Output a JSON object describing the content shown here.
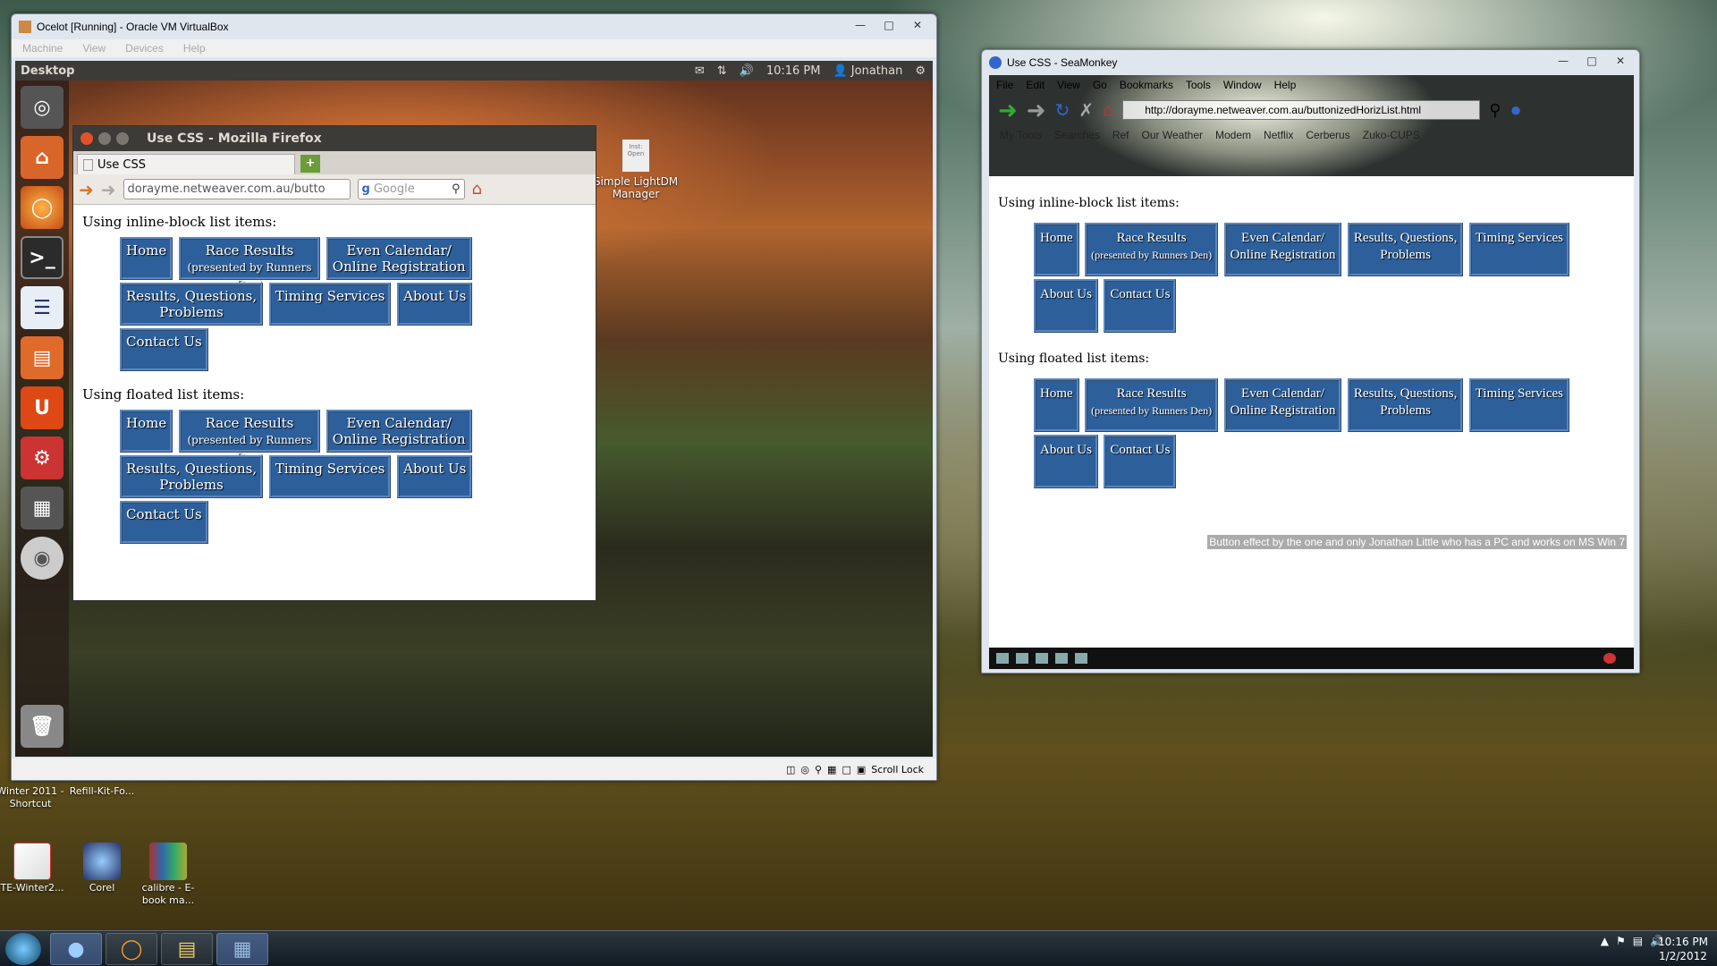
{
  "vbox": {
    "title": "Ocelot [Running] - Oracle VM VirtualBox",
    "menu": [
      "Machine",
      "View",
      "Devices",
      "Help"
    ],
    "status_right": "Scroll Lock"
  },
  "ubuntu": {
    "panel_title": "Desktop",
    "clock": "10:16 PM",
    "user": "Jonathan",
    "desktop_icon_label": "Simple LightDM Manager",
    "desktop_icon_small": "Inst: Open"
  },
  "firefox": {
    "title": "Use CSS - Mozilla Firefox",
    "tab": "Use CSS",
    "url": "dorayme.netweaver.com.au/butto",
    "search_placeholder": "Google"
  },
  "page": {
    "heading_inline": "Using inline-block list items:",
    "heading_float": "Using floated list items:",
    "buttons": {
      "home": "Home",
      "race": "Race Results",
      "race_sub": "(presented by Runners Den)",
      "even1": "Even Calendar/",
      "even2": "Online Registration",
      "rqp1": "Results, Questions,",
      "rqp2": "Problems",
      "timing": "Timing Services",
      "about": "About Us",
      "contact": "Contact Us"
    },
    "credit": "Button effect by the one and only Jonathan Little who has a PC and works on MS Win 7"
  },
  "seamonkey": {
    "title": "Use CSS - SeaMonkey",
    "menu": [
      "File",
      "Edit",
      "View",
      "Go",
      "Bookmarks",
      "Tools",
      "Window",
      "Help"
    ],
    "url": "http://dorayme.netweaver.com.au/buttonizedHorizList.html",
    "bookmarks": [
      "My Tools",
      "Searches",
      "Ref",
      "Our Weather",
      "Modem",
      "Netflix",
      "Cerberus",
      "Zuko-CUPS"
    ]
  },
  "desktop_icons": [
    {
      "label": "Winter 2011 - Shortcut"
    },
    {
      "label": "Refill-Kit-Fo..."
    },
    {
      "label": "TE-Winter2..."
    },
    {
      "label": "Corel"
    },
    {
      "label": "calibre - E-book ma..."
    }
  ],
  "taskbar": {
    "time": "10:16 PM",
    "date": "1/2/2012"
  }
}
